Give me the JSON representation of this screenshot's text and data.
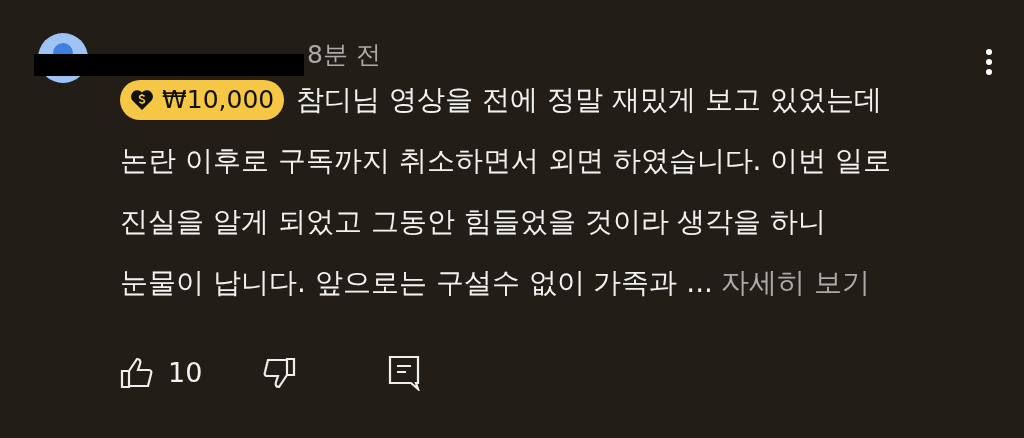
{
  "comment": {
    "time": "8분 전",
    "donation": "₩10,000",
    "lines": [
      "참디님 영상을 전에 정말 재밌게 보고 있었는데",
      "논란 이후로 구독까지 취소하면서 외면 하였습니다. 이번 일로",
      "진실을 알게 되었고 그동안 힘들었을 것이라 생각을 하니",
      "눈물이 납니다. 앞으로는 구설수 없이 가족과 ..."
    ],
    "read_more": "자세히 보기",
    "likes": "10"
  }
}
